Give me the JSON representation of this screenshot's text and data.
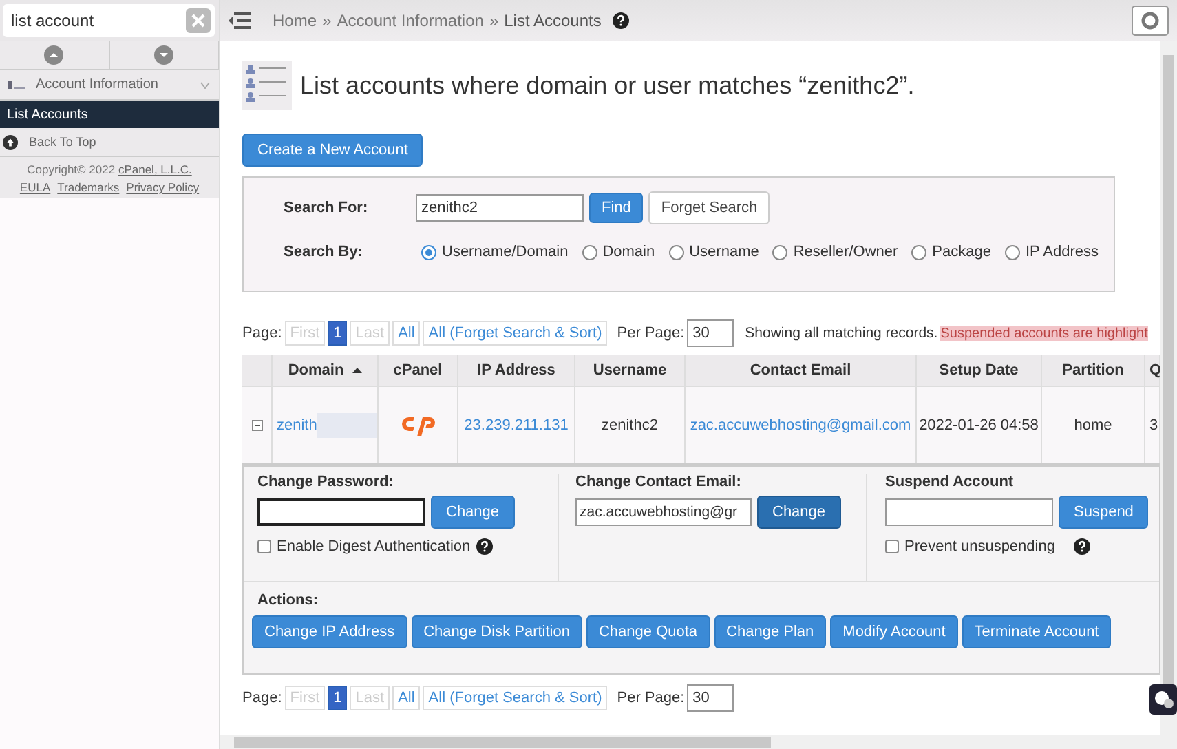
{
  "sidebar": {
    "search_value": "list account",
    "category": "Account Information",
    "items": [
      {
        "label": "List Accounts",
        "selected": true
      }
    ],
    "back_to_top": "Back To Top",
    "copyright": "Copyright© 2022",
    "copyright_link": "cPanel, L.L.C.",
    "links": [
      "EULA",
      "Trademarks",
      "Privacy Policy"
    ]
  },
  "breadcrumb": {
    "items": [
      "Home",
      "Account Information",
      "List Accounts"
    ],
    "separator": "»"
  },
  "page_title": "List accounts where domain or user matches “zenithc2”.",
  "create_button": "Create a New Account",
  "search_form": {
    "search_for_label": "Search For:",
    "value": "zenithc2",
    "find_button": "Find",
    "forget_button": "Forget Search",
    "search_by_label": "Search By:",
    "options": [
      {
        "label": "Username/Domain",
        "selected": true
      },
      {
        "label": "Domain",
        "selected": false
      },
      {
        "label": "Username",
        "selected": false
      },
      {
        "label": "Reseller/Owner",
        "selected": false
      },
      {
        "label": "Package",
        "selected": false
      },
      {
        "label": "IP Address",
        "selected": false
      }
    ]
  },
  "paginations": [
    {
      "label": "Page:",
      "pages": [
        {
          "label": "First",
          "kind": "disabled"
        },
        {
          "label": "1",
          "kind": "current"
        },
        {
          "label": "Last",
          "kind": "disabled"
        },
        {
          "label": "All",
          "kind": "link"
        },
        {
          "label": "All (Forget Search & Sort)",
          "kind": "link"
        }
      ],
      "per_page_label": "Per Page:",
      "per_page": "30",
      "status": "Showing all matching records.",
      "notice": "Suspended accounts are highlight"
    },
    {
      "label": "Page:",
      "pages": [
        {
          "label": "First",
          "kind": "disabled"
        },
        {
          "label": "1",
          "kind": "current"
        },
        {
          "label": "Last",
          "kind": "disabled"
        },
        {
          "label": "All",
          "kind": "link"
        },
        {
          "label": "All (Forget Search & Sort)",
          "kind": "link"
        }
      ],
      "per_page_label": "Per Page:",
      "per_page": "30"
    }
  ],
  "table": {
    "columns": [
      {
        "label": "Domain",
        "sorted": true
      },
      {
        "label": "cPanel"
      },
      {
        "label": "IP Address"
      },
      {
        "label": "Username"
      },
      {
        "label": "Contact Email"
      },
      {
        "label": "Setup Date"
      },
      {
        "label": "Partition"
      },
      {
        "label": "Q"
      }
    ],
    "rows": [
      {
        "expanded": true,
        "cells": [
          {
            "kind": "blurred_link",
            "text": "zenith"
          },
          {
            "kind": "logo"
          },
          {
            "kind": "link",
            "text": "23.239.211.131"
          },
          {
            "kind": "text",
            "text": "zenithc2"
          },
          {
            "kind": "link",
            "text": "zac.accuwebhosting@gmail.com"
          },
          {
            "kind": "text",
            "text": "2022-01-26 04:58"
          },
          {
            "kind": "text",
            "text": "home"
          },
          {
            "kind": "text",
            "text": "3"
          }
        ]
      }
    ]
  },
  "details": {
    "password": {
      "label": "Change Password:",
      "button": "Change",
      "checkbox": {
        "label": "Enable Digest Authentication",
        "checked": false
      }
    },
    "email": {
      "label": "Change Contact Email:",
      "value": "zac.accuwebhosting@gr",
      "button": "Change"
    },
    "suspend": {
      "label": "Suspend Account",
      "button": "Suspend",
      "checkbox": {
        "label": "Prevent unsuspending",
        "checked": false
      }
    },
    "actions_label": "Actions:",
    "actions": [
      "Change IP Address",
      "Change Disk Partition",
      "Change Quota",
      "Change Plan",
      "Modify Account",
      "Terminate Account"
    ]
  }
}
